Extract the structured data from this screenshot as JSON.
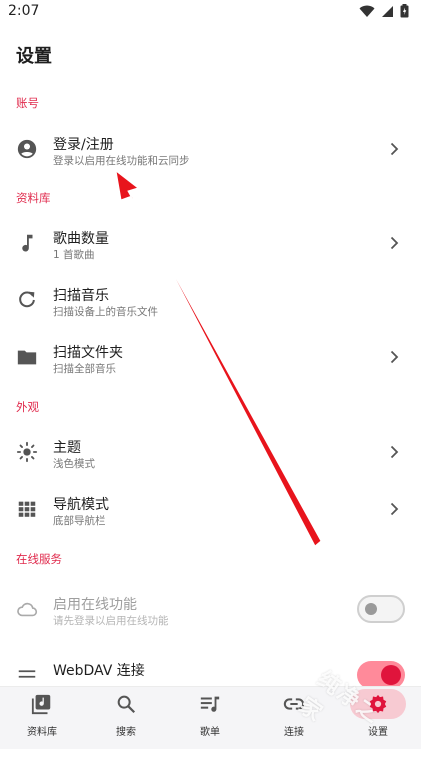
{
  "status_bar": {
    "time": "2:07"
  },
  "page_title": "设置",
  "sections": {
    "account": "账号",
    "library": "资料库",
    "appearance": "外观",
    "online": "在线服务"
  },
  "rows": {
    "login": {
      "title": "登录/注册",
      "subtitle": "登录以启用在线功能和云同步",
      "icon": "account-circle-icon"
    },
    "song_count": {
      "title": "歌曲数量",
      "subtitle": "1 首歌曲",
      "icon": "music-note-icon"
    },
    "scan_music": {
      "title": "扫描音乐",
      "subtitle": "扫描设备上的音乐文件",
      "icon": "refresh-icon"
    },
    "scan_folder": {
      "title": "扫描文件夹",
      "subtitle": "扫描全部音乐",
      "icon": "folder-icon"
    },
    "theme": {
      "title": "主题",
      "subtitle": "浅色模式",
      "icon": "sun-icon"
    },
    "nav_mode": {
      "title": "导航模式",
      "subtitle": "底部导航栏",
      "icon": "grid-icon"
    },
    "online_features": {
      "title": "启用在线功能",
      "subtitle": "请先登录以启用在线功能",
      "icon": "cloud-icon",
      "enabled": false
    },
    "webdav": {
      "title": "WebDAV 连接",
      "enabled": true
    }
  },
  "bottom_nav": [
    {
      "label": "资料库",
      "icon": "library-icon",
      "active": false
    },
    {
      "label": "搜索",
      "icon": "search-icon",
      "active": false
    },
    {
      "label": "歌单",
      "icon": "playlist-icon",
      "active": false
    },
    {
      "label": "连接",
      "icon": "link-icon",
      "active": false
    },
    {
      "label": "设置",
      "icon": "settings-icon",
      "active": true
    }
  ],
  "watermark": "纯净之家",
  "colors": {
    "accent": "#e02b4d",
    "arrow": "#e8141c",
    "toggle_on": "#e0143c"
  }
}
